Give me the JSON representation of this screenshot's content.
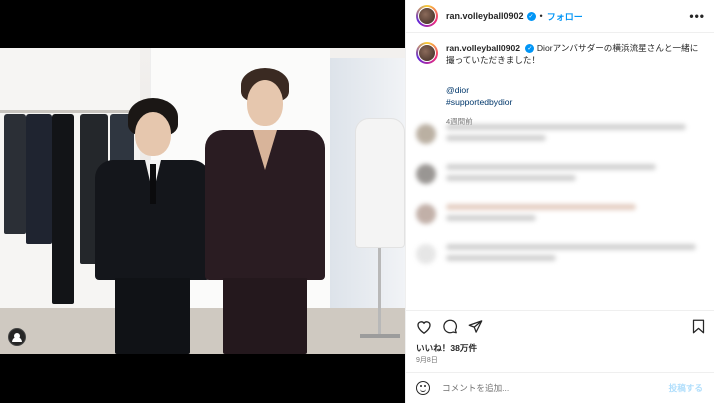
{
  "header": {
    "username": "ran.volleyball0902",
    "separator": "•",
    "follow_label": "フォロー",
    "more_label": "•••"
  },
  "caption": {
    "username": "ran.volleyball0902",
    "text": "Diorアンバサダーの横浜流星さんと一緒に撮っていただきました！",
    "tags": [
      "@dior",
      "#supportedbydior"
    ],
    "time_ago": "4週間前"
  },
  "icons": {
    "header_avatar": "avatar-icon",
    "verified": "verified-badge-icon",
    "more": "more-options-icon",
    "like": "heart-icon",
    "comment": "comment-icon",
    "share": "share-icon",
    "save": "bookmark-icon",
    "emoji": "emoji-icon",
    "user_tag": "user-tag-icon"
  },
  "engagement": {
    "likes": "いいね！38万件",
    "date": "9月8日"
  },
  "comment_box": {
    "placeholder": "コメントを追加...",
    "post_label": "投稿する"
  },
  "colors": {
    "link": "#00376b",
    "accent": "#0095f6",
    "muted": "#737373"
  }
}
